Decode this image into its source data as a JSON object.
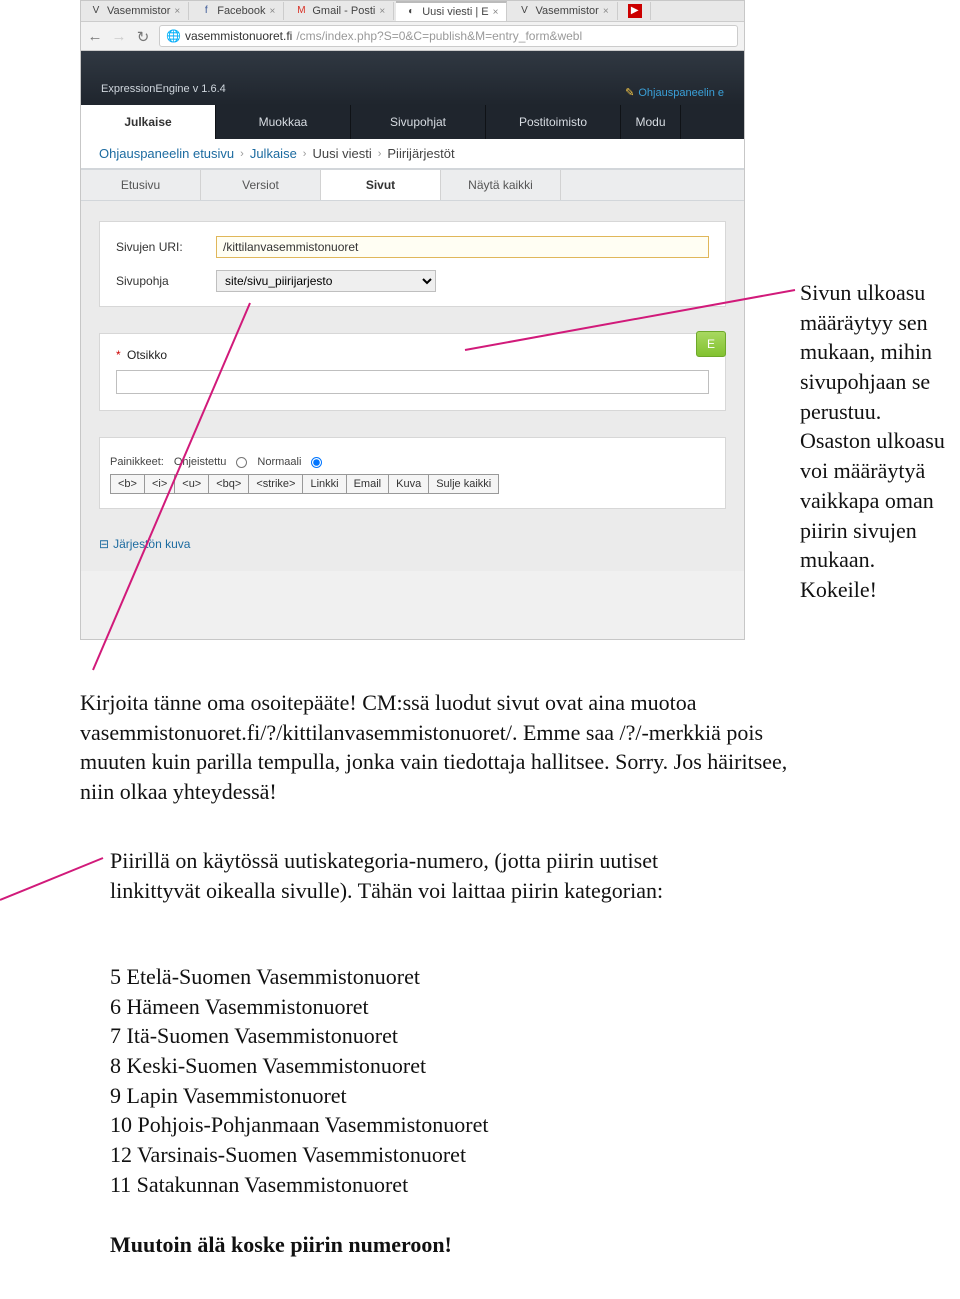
{
  "browser": {
    "tabs": [
      {
        "title": "Vasemmistor",
        "fav": "V"
      },
      {
        "title": "Facebook",
        "fav": "f"
      },
      {
        "title": "Gmail - Posti",
        "fav": "M"
      },
      {
        "title": "Uusi viesti | E",
        "fav": "◐",
        "active": true
      },
      {
        "title": "Vasemmistor",
        "fav": "V"
      },
      {
        "title": "",
        "fav": "▶"
      }
    ],
    "url_host": "vasemmistonuoret.fi",
    "url_path": "/cms/index.php?S=0&C=publish&M=entry_form&webl"
  },
  "ee": {
    "version": "ExpressionEngine  v 1.6.4",
    "help_link": "Ohjauspaneelin e",
    "nav": [
      {
        "label": "Julkaise",
        "active": true
      },
      {
        "label": "Muokkaa"
      },
      {
        "label": "Sivupohjat"
      },
      {
        "label": "Postitoimisto"
      },
      {
        "label": "Modu"
      }
    ],
    "breadcrumb": {
      "a": "Ohjauspaneelin etusivu",
      "b": "Julkaise",
      "c": "Uusi viesti",
      "d": "Piirijärjestöt"
    },
    "subtabs": [
      {
        "label": "Etusivu"
      },
      {
        "label": "Versiot"
      },
      {
        "label": "Sivut",
        "active": true
      },
      {
        "label": "Näytä kaikki"
      }
    ],
    "form": {
      "uri_label": "Sivujen URI:",
      "uri_value": "/kittilanvasemmistonuoret",
      "tpl_label": "Sivupohja",
      "tpl_value": "site/sivu_piirijarjesto",
      "otsikko_label": "Otsikko",
      "green_E": "E",
      "paini_label": "Painikkeet:",
      "paini_a": "Ohjeistettu",
      "paini_b": "Normaali",
      "toolbar": [
        "<b>",
        "<i>",
        "<u>",
        "<bq>",
        "<strike>",
        "Linkki",
        "Email",
        "Kuva",
        "Sulje kaikki"
      ],
      "disclosure": "Järjestön kuva"
    }
  },
  "annotations": {
    "right": "Sivun ulkoasu määräytyy sen mukaan, mihin sivupohjaan se perustuu. Osaston ulkoasu voi määräytyä vaikkapa oman piirin sivujen mukaan. Kokeile!",
    "mid": "Kirjoita tänne oma osoitepääte! CM:ssä luodut sivut ovat aina muotoa vasemmistonuoret.fi/?/kittilanvasemmistonuoret/. Emme saa /?/-merkkiä pois muuten kuin parilla tempulla, jonka vain tiedottaja hallitsee. Sorry. Jos häiritsee, niin olkaa yhteydessä!",
    "lower_intro": "Piirillä on käytössä uutiskategoria-numero, (jotta piirin uutiset linkittyvät oikealla sivulle). Tähän voi laittaa piirin kategorian:",
    "categories": [
      "5 Etelä-Suomen Vasemmistonuoret",
      "6 Hämeen Vasemmistonuoret",
      "7 Itä-Suomen Vasemmistonuoret",
      "8 Keski-Suomen Vasemmistonuoret",
      "9 Lapin Vasemmistonuoret",
      "10 Pohjois-Pohjanmaan Vasemmistonuoret",
      "12 Varsinais-Suomen Vasemmistonuoret",
      "11 Satakunnan Vasemmistonuoret"
    ],
    "warning": "Muutoin älä koske piirin numeroon!"
  }
}
